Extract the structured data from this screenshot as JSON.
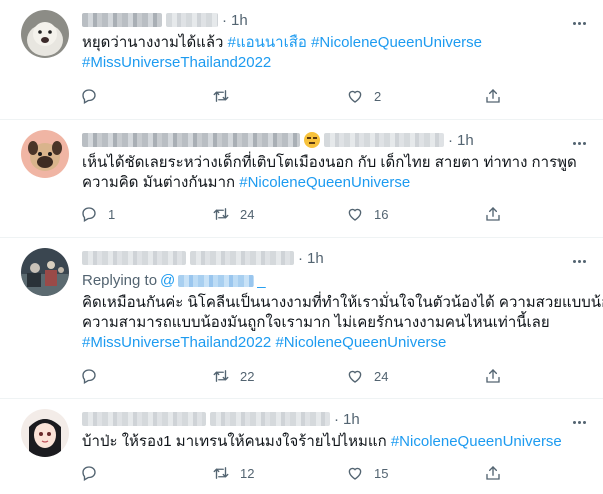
{
  "tweets": [
    {
      "time": "1h",
      "text_lines": [
        [
          {
            "text": "หยุดว่านางงามได้แล้ว ",
            "tag": false
          },
          {
            "text": "#แอนนาเสือ",
            "tag": true
          },
          {
            "text": " ",
            "tag": false
          },
          {
            "text": "#NicoleneQueenUniverse",
            "tag": true
          }
        ],
        [
          {
            "text": "#MissUniverseThailand2022",
            "tag": true
          }
        ]
      ],
      "replies": "",
      "retweets": "",
      "likes": "2"
    },
    {
      "time": "1h",
      "text_lines": [
        [
          {
            "text": "เห็นได้ชัดเลยระหว่างเด็กที่เติบโตเมืองนอก กับ เด็กไทย สายตา ท่าทาง การพูด",
            "tag": false
          }
        ],
        [
          {
            "text": "ความคิด มันต่างกันมาก ",
            "tag": false
          },
          {
            "text": "#NicoleneQueenUniverse",
            "tag": true
          }
        ]
      ],
      "replies": "1",
      "retweets": "24",
      "likes": "16"
    },
    {
      "time": "1h",
      "replying_to_label": "Replying to",
      "replying_to_handle": "@",
      "replying_to_suffix": "_",
      "text_lines": [
        [
          {
            "text": "คิดเหมือนกันค่ะ นิโคลีนเป็นนางงามที่ทำให้เรามั่นใจในตัวน้องได้ ความสวยแบบน้อง",
            "tag": false
          }
        ],
        [
          {
            "text": "ความสามารถแบบน้องมันถูกใจเรามาก ไม่เคยรักนางงามคนไหนเท่านี้เลย",
            "tag": false
          }
        ],
        [
          {
            "text": "#MissUniverseThailand2022",
            "tag": true
          },
          {
            "text": " ",
            "tag": false
          },
          {
            "text": "#NicoleneQueenUniverse",
            "tag": true
          }
        ]
      ],
      "replies": "",
      "retweets": "22",
      "likes": "24"
    },
    {
      "time": "1h",
      "text_lines": [
        [
          {
            "text": "บ้าป่ะ ให้รอง1 มาเทรนให้คนมงใจร้ายไปไหมแก ",
            "tag": false
          },
          {
            "text": "#NicoleneQueenUniverse",
            "tag": true
          }
        ]
      ],
      "replies": "",
      "retweets": "12",
      "likes": "15"
    }
  ],
  "icons": {
    "reply": "reply-icon",
    "retweet": "retweet-icon",
    "like": "like-icon",
    "share": "share-icon",
    "more": "more-icon"
  },
  "colors": {
    "hashtag": "#1d9bf0",
    "secondary_text": "#536471",
    "divider": "#eff3f4"
  }
}
